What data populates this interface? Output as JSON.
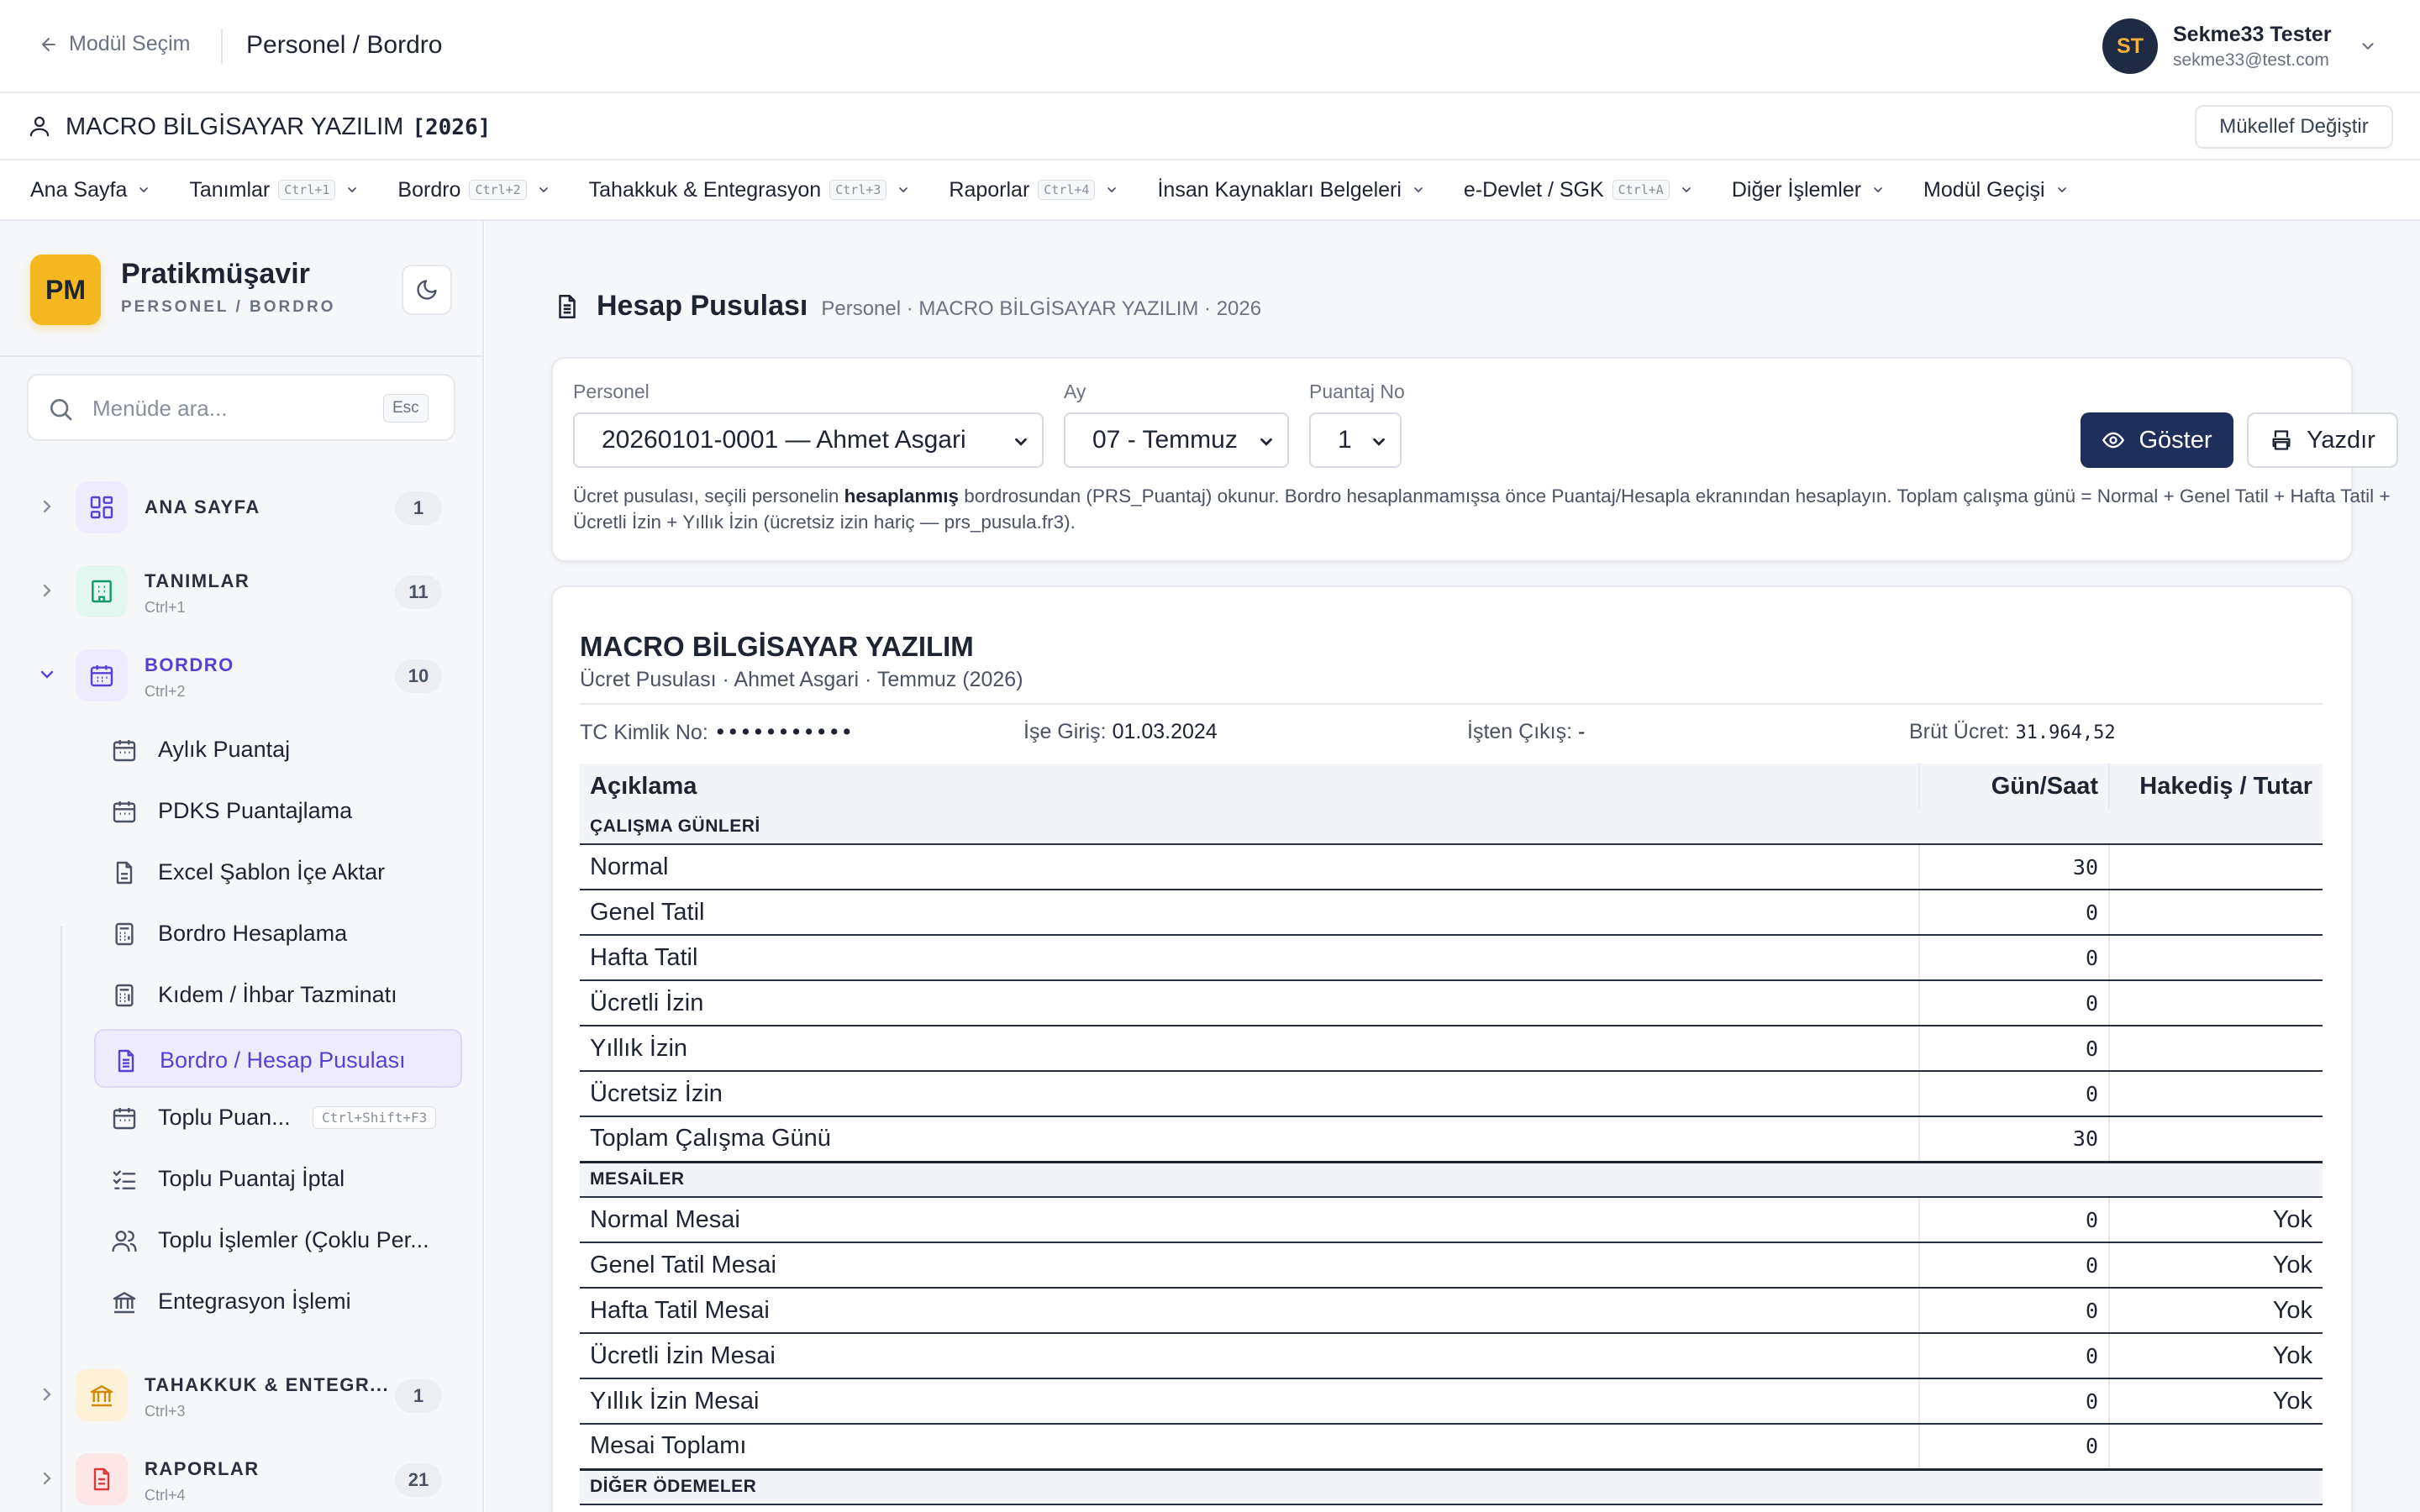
{
  "topbar": {
    "back_label": "Modül Seçim",
    "breadcrumb": "Personel / Bordro"
  },
  "user": {
    "initials": "ST",
    "name": "Sekme33 Tester",
    "email": "sekme33@test.com"
  },
  "company": {
    "name": "MACRO BİLGİSAYAR YAZILIM",
    "year": "[2026]",
    "change_button": "Mükellef Değiştir"
  },
  "nav": [
    {
      "label": "Ana Sayfa",
      "kbd": ""
    },
    {
      "label": "Tanımlar",
      "kbd": "Ctrl+1"
    },
    {
      "label": "Bordro",
      "kbd": "Ctrl+2"
    },
    {
      "label": "Tahakkuk & Entegrasyon",
      "kbd": "Ctrl+3"
    },
    {
      "label": "Raporlar",
      "kbd": "Ctrl+4"
    },
    {
      "label": "İnsan Kaynakları Belgeleri",
      "kbd": ""
    },
    {
      "label": "e-Devlet / SGK",
      "kbd": "Ctrl+A"
    },
    {
      "label": "Diğer İşlemler",
      "kbd": ""
    },
    {
      "label": "Modül Geçişi",
      "kbd": ""
    }
  ],
  "sidebar": {
    "logo": "PM",
    "brand": "Pratikmüşavir",
    "brand_sub": "PERSONEL / BORDRO",
    "search_placeholder": "Menüde ara...",
    "search_kbd": "Esc",
    "groups": [
      {
        "title": "ANA SAYFA",
        "sub": "",
        "count": "1"
      },
      {
        "title": "TANIMLAR",
        "sub": "Ctrl+1",
        "count": "11"
      },
      {
        "title": "BORDRO",
        "sub": "Ctrl+2",
        "count": "10"
      },
      {
        "title": "TAHAKKUK & ENTEGR...",
        "sub": "Ctrl+3",
        "count": "1"
      },
      {
        "title": "RAPORLAR",
        "sub": "Ctrl+4",
        "count": "21"
      }
    ],
    "items": [
      {
        "label": "Aylık Puantaj"
      },
      {
        "label": "PDKS Puantajlama"
      },
      {
        "label": "Excel Şablon İçe Aktar"
      },
      {
        "label": "Bordro Hesaplama"
      },
      {
        "label": "Kıdem / İhbar Tazminatı"
      },
      {
        "label": "Bordro / Hesap Pusulası"
      },
      {
        "label": "Toplu Puan...",
        "kbd": "Ctrl+Shift+F3"
      },
      {
        "label": "Toplu Puantaj İptal"
      },
      {
        "label": "Toplu İşlemler (Çoklu Per..."
      },
      {
        "label": "Entegrasyon İşlemi"
      }
    ]
  },
  "page": {
    "title": "Hesap Pusulası",
    "subtitle": "Personel · MACRO BİLGİSAYAR YAZILIM · 2026"
  },
  "filters": {
    "personel_label": "Personel",
    "personel_value": "20260101-0001 — Ahmet Asgari",
    "ay_label": "Ay",
    "ay_value": "07 - Temmuz",
    "puantaj_label": "Puantaj No",
    "puantaj_value": "1",
    "show_button": "Göster",
    "print_button": "Yazdır",
    "note_pre": "Ücret pusulası, seçili personelin ",
    "note_bold": "hesaplanmış",
    "note_post": " bordrosundan (PRS_Puantaj) okunur. Bordro hesaplanmamışsa önce Puantaj/Hesapla ekranından hesaplayın. Toplam çalışma günü = Normal + Genel Tatil + Hafta Tatil + Ücretli İzin + Yıllık İzin (ücretsiz izin hariç — prs_pusula.fr3)."
  },
  "payslip": {
    "company": "MACRO BİLGİSAYAR YAZILIM",
    "sub": "Ücret Pusulası · Ahmet Asgari · Temmuz (2026)",
    "tc_label": "TC Kimlik No:",
    "tc_value": "•••••••••••",
    "ise_giris_label": "İşe Giriş:",
    "ise_giris_value": "01.03.2024",
    "isten_cikis_label": "İşten Çıkış:",
    "isten_cikis_value": "-",
    "brut_label": "Brüt Ücret:",
    "brut_value": "31.964,52",
    "col_desc": "Açıklama",
    "col_days": "Gün/Saat",
    "col_amount": "Hakediş / Tutar",
    "sec_calisma": "ÇALIŞMA GÜNLERİ",
    "calisma_rows": [
      {
        "desc": "Normal",
        "val": "30",
        "amt": ""
      },
      {
        "desc": "Genel Tatil",
        "val": "0",
        "amt": ""
      },
      {
        "desc": "Hafta Tatil",
        "val": "0",
        "amt": ""
      },
      {
        "desc": "Ücretli İzin",
        "val": "0",
        "amt": ""
      },
      {
        "desc": "Yıllık İzin",
        "val": "0",
        "amt": ""
      },
      {
        "desc": "Ücretsiz İzin",
        "val": "0",
        "amt": ""
      }
    ],
    "toplam_calisma": {
      "desc": "Toplam Çalışma Günü",
      "val": "30"
    },
    "sec_mesai": "MESAİLER",
    "mesai_rows": [
      {
        "desc": "Normal Mesai",
        "val": "0",
        "amt": "Yok"
      },
      {
        "desc": "Genel Tatil Mesai",
        "val": "0",
        "amt": "Yok"
      },
      {
        "desc": "Hafta Tatil Mesai",
        "val": "0",
        "amt": "Yok"
      },
      {
        "desc": "Ücretli İzin Mesai",
        "val": "0",
        "amt": "Yok"
      },
      {
        "desc": "Yıllık İzin Mesai",
        "val": "0",
        "amt": "Yok"
      }
    ],
    "mesai_toplam": {
      "desc": "Mesai Toplamı",
      "val": "0"
    },
    "sec_diger": "DİĞER ÖDEMELER"
  }
}
